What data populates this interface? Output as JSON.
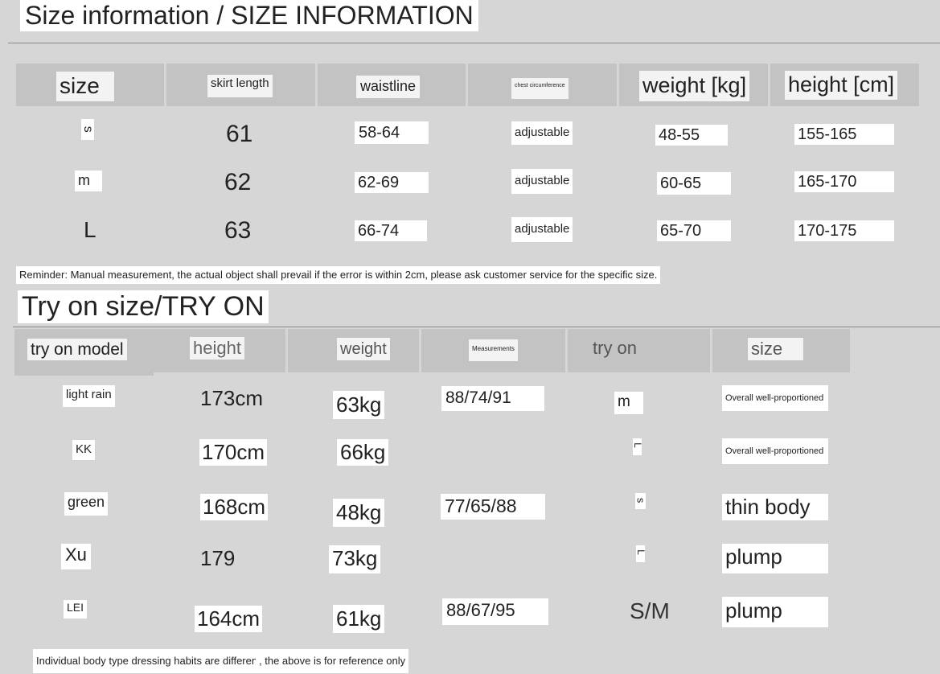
{
  "size_section": {
    "title": "Size information / SIZE INFORMATION",
    "headers": [
      "size",
      "skirt length",
      "waistline",
      "chest circumference",
      "weight [kg]",
      "height [cm]"
    ],
    "rows": [
      [
        "s",
        "61",
        "58-64",
        "adjustable",
        "48-55",
        "155-165"
      ],
      [
        "m",
        "62",
        "62-69",
        "adjustable",
        "60-65",
        "165-170"
      ],
      [
        "L",
        "63",
        "66-74",
        "adjustable",
        "65-70",
        "170-175"
      ]
    ],
    "reminder": "Reminder: Manual measurement, the actual object shall prevail if the error is within 2cm, please ask customer service for the specific size."
  },
  "tryon_section": {
    "title": "Try on size/TRY ON",
    "headers": [
      "try on model",
      "height",
      "weight",
      "Measurements",
      "try on",
      "size"
    ],
    "rows": [
      [
        "light rain",
        "173cm",
        "63kg",
        "88/74/91",
        "m",
        "Overall well-proportioned"
      ],
      [
        "KK",
        "170cm",
        "66kg",
        "",
        "L",
        "Overall well-proportioned"
      ],
      [
        "green",
        "168cm",
        "48kg",
        "77/65/88",
        "s",
        "thin body"
      ],
      [
        "Xu",
        "179",
        "73kg",
        "",
        "L",
        "plump"
      ],
      [
        "LEI",
        "164cm",
        "61kg",
        "88/67/95",
        "S/M",
        "plump"
      ]
    ],
    "footnote_a": "Individual body type dressing habits are different",
    "footnote_b": ", the above is for reference only"
  }
}
